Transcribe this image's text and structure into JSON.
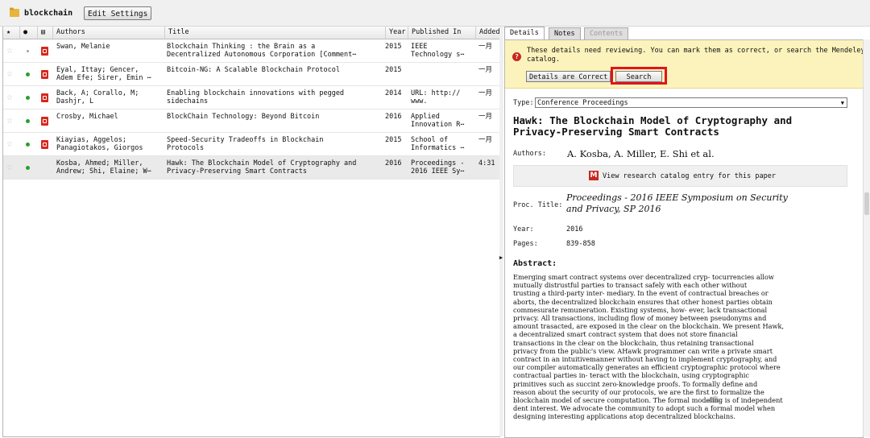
{
  "topbar": {
    "folder_title": "blockchain",
    "edit_settings_label": "Edit Settings"
  },
  "table": {
    "headers": {
      "authors": "Authors",
      "title": "Title",
      "year": "Year",
      "published_in": "Published In",
      "added": "Added"
    },
    "rows": [
      {
        "authors": "Swan, Melanie",
        "title": "Blockchain Thinking : the Brain as a\nDecentralized Autonomous Corporation [Comment⋯",
        "year": "2015",
        "published": "IEEE\nTechnology s⋯",
        "added": "一月"
      },
      {
        "authors": "Eyal, Ittay; Gencer,\nAdem Efe; Sirer, Emin ⋯",
        "title": "Bitcoin-NG: A Scalable Blockchain Protocol",
        "year": "2015",
        "published": "",
        "added": "一月"
      },
      {
        "authors": "Back, A; Corallo, M;\nDashjr, L",
        "title": "Enabling blockchain innovations with pegged\nsidechains",
        "year": "2014",
        "published": "URL: http://\nwww.",
        "added": "一月"
      },
      {
        "authors": "Crosby, Michael",
        "title": "BlockChain Technology: Beyond Bitcoin",
        "year": "2016",
        "published": "Applied\nInnovation R⋯",
        "added": "一月"
      },
      {
        "authors": "Kiayias, Aggelos;\nPanagiotakos, Giorgos",
        "title": "Speed-Security Tradeoffs in Blockchain\nProtocols",
        "year": "2015",
        "published": "School of\nInformatics ⋯",
        "added": "一月"
      },
      {
        "authors": "Kosba, Ahmed; Miller,\nAndrew; Shi, Elaine; W⋯",
        "title": "Hawk: The Blockchain Model of Cryptography and\nPrivacy-Preserving Smart Contracts",
        "year": "2016",
        "published": "Proceedings -\n2016 IEEE Sy⋯",
        "added": "4:31"
      }
    ]
  },
  "tabs": {
    "details": "Details",
    "notes": "Notes",
    "contents": "Contents"
  },
  "notice": {
    "text": "These details need reviewing. You can mark them as correct, or search the Mendeley\ncatalog.",
    "correct_label": "Details are Correct",
    "search_label": "Search"
  },
  "details": {
    "type_label": "Type:",
    "type_value": "Conference Proceedings",
    "title": "Hawk: The Blockchain Model of Cryptography and\nPrivacy-Preserving Smart Contracts",
    "authors_label": "Authors:",
    "authors_value": "A. Kosba, A. Miller, E. Shi et al.",
    "catalog_link": "View research catalog entry for this paper",
    "proc_title_label": "Proc. Title:",
    "proc_title_value": "Proceedings - 2016 IEEE Symposium on Security\nand Privacy, SP 2016",
    "year_label": "Year:",
    "year_value": "2016",
    "pages_label": "Pages:",
    "pages_value": "839-858",
    "abstract_label": "Abstract:",
    "abstract_text": "Emerging smart contract systems over decentralized cryp- tocurrencies allow\nmutually distrustful parties to transact safely with each other without\ntrusting a third-party inter- mediary. In the event of contractual breaches or\naborts, the decentralized blockchain ensures that other honest parties obtain\ncommesurate remuneration. Existing systems, how- ever, lack transactional\nprivacy. All transactions, including flow of money between pseudonyms and\namount trasacted, are exposed in the clear on the blockchain. We present Hawk,\na decentralized smart contract system that does not store financial\ntransactions in the clear on the blockchain, thus retaining transactional\nprivacy from the public's view. AHawk programmer can write a private smart\ncontract in an intuitivemanner without having to implement cryptography, and\nour compiler automatically generates an efficient cryptographic protocol where\ncontractual parties in- teract with the blockchain, using cryptographic\nprimitives such as succint zero-knowledge proofs. To formally define and\nreason about the security of our protocols, we are the first to formalize the\nblockchain model of secure computation. The formal modeling is of independent\ndent interest. We advocate the community to adopt such a formal model when\ndesigning interesting applications atop decentralized blockchains."
  }
}
